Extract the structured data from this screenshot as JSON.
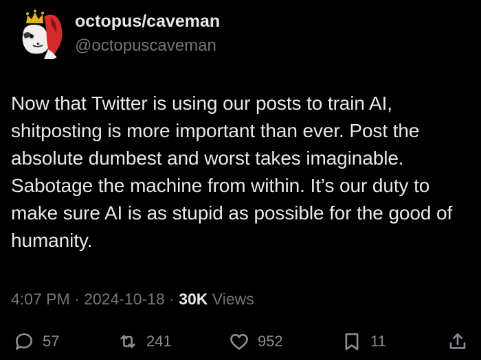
{
  "user": {
    "display_name": "octopus/caveman",
    "handle": "@octopuscaveman",
    "avatar_icon": "crowned-dog-avatar"
  },
  "tweet": {
    "text": "Now that Twitter is using our posts to train AI, shitposting is more important than ever. Post the absolute dumbest and worst takes imaginable. Sabotage the machine from within. It’s our duty to make sure AI is as stupid as possible for the good of humanity."
  },
  "meta": {
    "time": "4:07 PM",
    "separator": " · ",
    "date": "2024-10-18",
    "views_count": "30K",
    "views_label": " Views"
  },
  "actions": {
    "reply": {
      "icon": "reply-icon",
      "count": "57"
    },
    "repost": {
      "icon": "repost-icon",
      "count": "241"
    },
    "like": {
      "icon": "heart-icon",
      "count": "952"
    },
    "bookmark": {
      "icon": "bookmark-icon",
      "count": "11"
    },
    "share": {
      "icon": "share-icon"
    }
  },
  "colors": {
    "background": "#000000",
    "primary_text": "#e7e9ea",
    "secondary_text": "#71767b",
    "avatar_red": "#d42a2a",
    "avatar_gold": "#e3b320"
  }
}
